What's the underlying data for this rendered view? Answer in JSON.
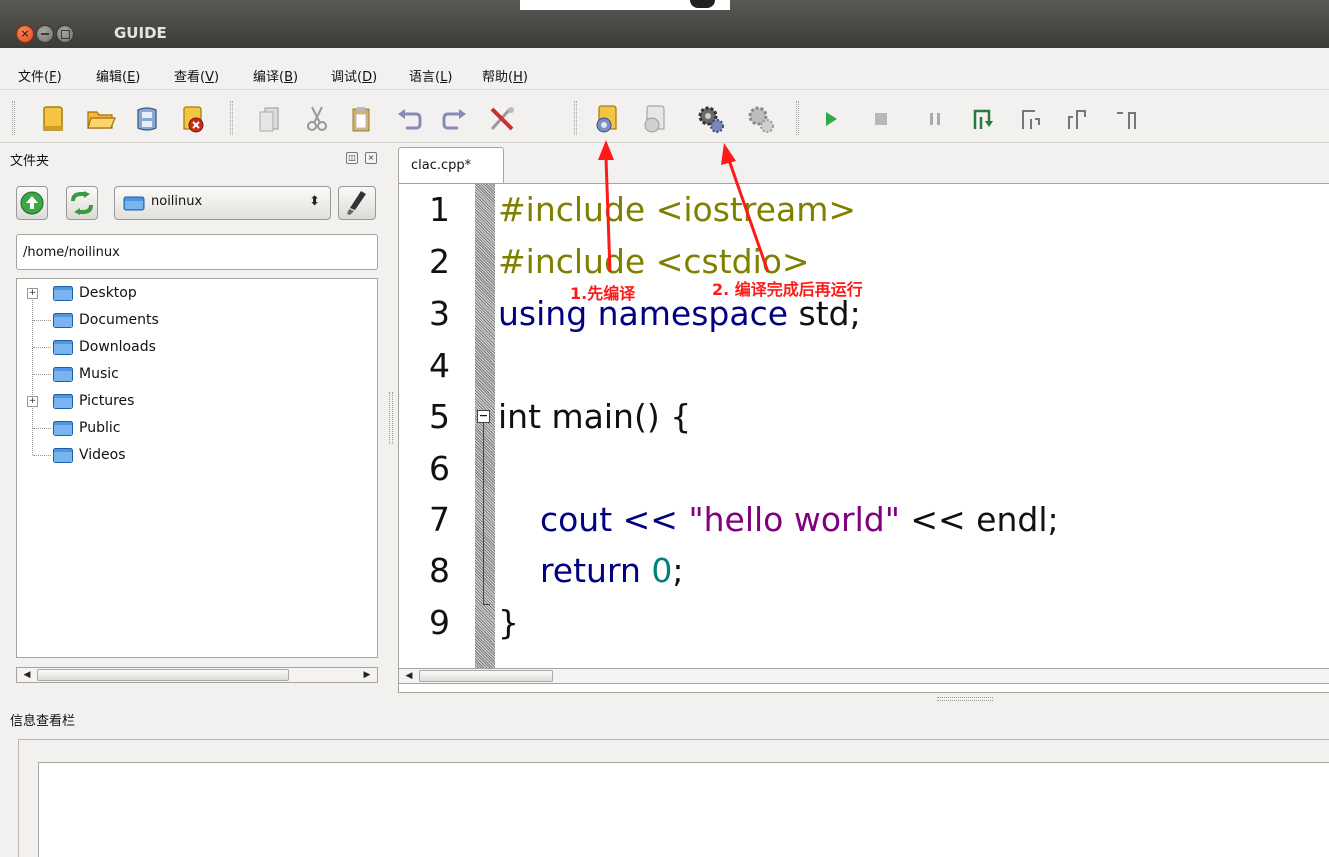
{
  "window": {
    "title": "GUIDE"
  },
  "menu": [
    {
      "label": "文件(",
      "acc": "F",
      "end": ")"
    },
    {
      "label": "编辑(",
      "acc": "E",
      "end": ")"
    },
    {
      "label": "查看(",
      "acc": "V",
      "end": ")"
    },
    {
      "label": "编译(",
      "acc": "B",
      "end": ")"
    },
    {
      "label": "调试(",
      "acc": "D",
      "end": ")"
    },
    {
      "label": "语言(",
      "acc": "L",
      "end": ")"
    },
    {
      "label": "帮助(",
      "acc": "H",
      "end": ")"
    }
  ],
  "toolbar": {
    "icons": [
      "new-file-icon",
      "open-folder-icon",
      "save-icon",
      "close-file-icon",
      "copy-icon",
      "cut-icon",
      "paste-icon",
      "undo-icon",
      "redo-icon",
      "settings-tools-icon",
      "compile-icon",
      "recompile-icon",
      "build-run-icon",
      "debug-run-icon",
      "run-play-icon",
      "stop-icon",
      "pause-icon",
      "step-into-icon",
      "step-over-icon",
      "step-out-icon",
      "step-back-icon"
    ]
  },
  "sidebar": {
    "title": "文件夹",
    "combo_value": "noilinux",
    "path": "/home/noilinux",
    "tree": [
      {
        "label": "Desktop",
        "expandable": true
      },
      {
        "label": "Documents",
        "expandable": false
      },
      {
        "label": "Downloads",
        "expandable": false
      },
      {
        "label": "Music",
        "expandable": false
      },
      {
        "label": "Pictures",
        "expandable": true
      },
      {
        "label": "Public",
        "expandable": false
      },
      {
        "label": "Videos",
        "expandable": false
      }
    ],
    "scroll_position": 0.55
  },
  "editor": {
    "tab_label": "clac.cpp*",
    "line_numbers": [
      "1",
      "2",
      "3",
      "4",
      "5",
      "6",
      "7",
      "8",
      "9"
    ],
    "code": {
      "l1": "#include <iostream>",
      "l2": "#include <cstdio>",
      "l3_kw": "using namespace",
      "l3_rest": " std;",
      "l5": "int main() {",
      "l7_a": "    cout << ",
      "l7_str": "\"hello world\"",
      "l7_b": " << endl;",
      "l8_kw": "    return ",
      "l8_num": "0",
      "l8_end": ";",
      "l9": "}"
    }
  },
  "annotations": {
    "label1": "1.先编译",
    "label2": "2. 编译完成后再运行",
    "color": "#ff1a1a"
  },
  "info_panel": {
    "title": "信息查看栏"
  }
}
